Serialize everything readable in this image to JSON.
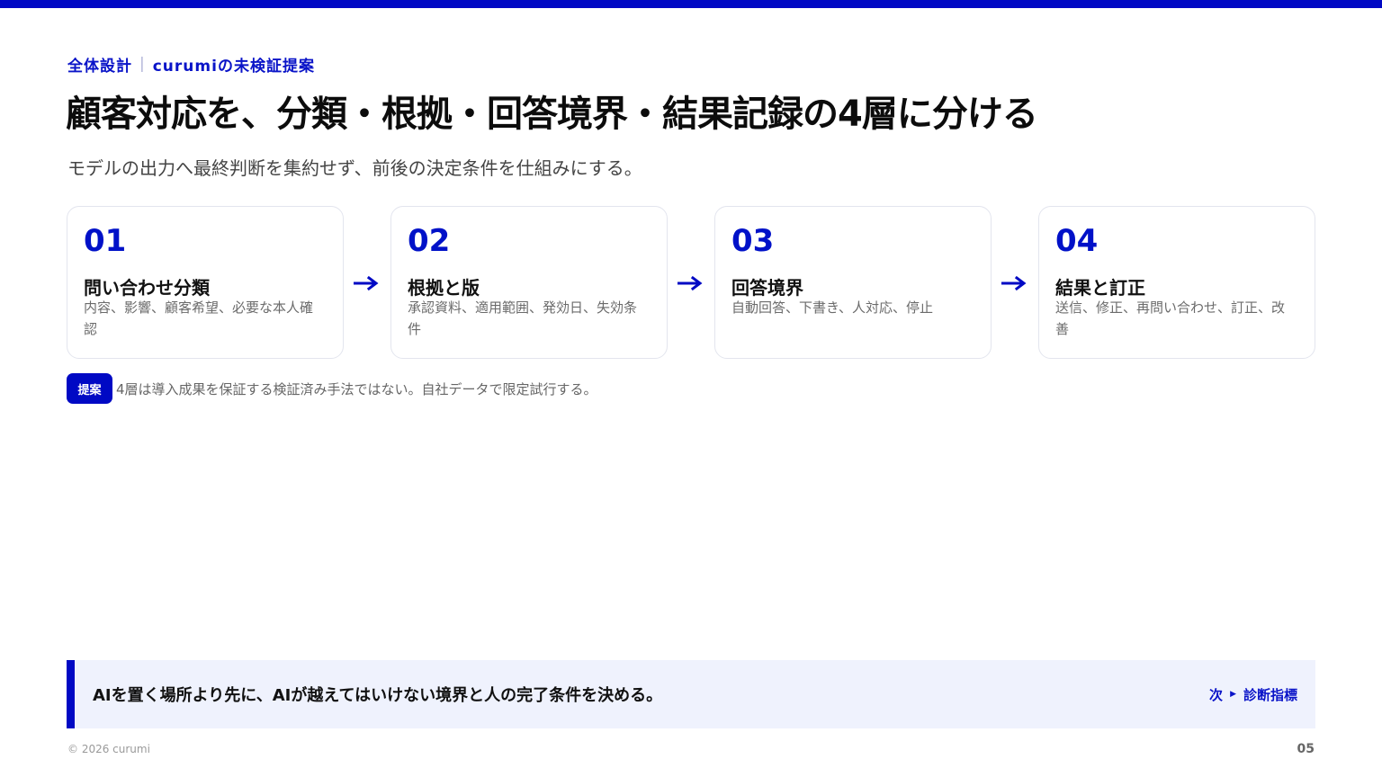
{
  "header": {
    "eyebrow_left": "全体設計",
    "eyebrow_right": "curumiの未検証提案",
    "title": "顧客対応を、分類・根拠・回答境界・結果記録の4層に分ける",
    "subtitle": "モデルの出力へ最終判断を集約せず、前後の決定条件を仕組みにする。"
  },
  "steps": [
    {
      "number": "01",
      "label": "問い合わせ分類",
      "desc": "内容、影響、顧客希望、必要な本人確認"
    },
    {
      "number": "02",
      "label": "根拠と版",
      "desc": "承認資料、適用範囲、発効日、失効条件"
    },
    {
      "number": "03",
      "label": "回答境界",
      "desc": "自動回答、下書き、人対応、停止"
    },
    {
      "number": "04",
      "label": "結果と訂正",
      "desc": "送信、修正、再問い合わせ、訂正、改善"
    }
  ],
  "note": {
    "badge": "提案",
    "text": "4層は導入成果を保証する検証済み手法ではない。自社データで限定試行する。"
  },
  "callout": {
    "message": "AIを置く場所より先に、AIが越えてはいけない境界と人の完了条件を決める。",
    "next_prefix": "次",
    "next_label": "診断指標"
  },
  "footer": {
    "copyright": "© 2026 curumi",
    "page_number": "05"
  },
  "colors": {
    "accent": "#0009c4",
    "callout_bg": "#eff2fd",
    "card_border": "#e3e5ee"
  }
}
